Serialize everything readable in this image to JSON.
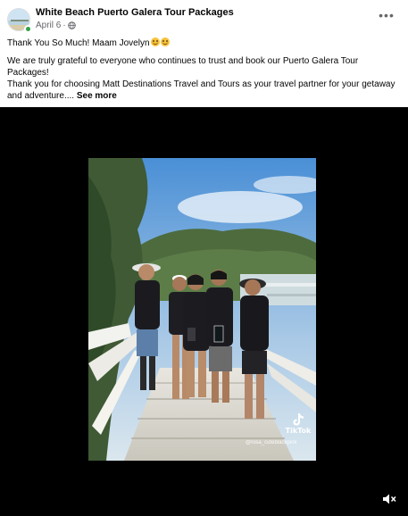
{
  "post": {
    "page_name": "White Beach Puerto Galera Tour Packages",
    "date": "April 6",
    "separator": "·",
    "more_label": "•••",
    "line1": "Thank You So Much! Maam Jovelyn",
    "line2": "We are truly grateful to everyone who continues to trust and book our Puerto Galera Tour Packages!",
    "line3": "Thank you for choosing Matt Destinations Travel and Tours as your travel partner for your getaway and adventure....",
    "see_more": "See more"
  },
  "video": {
    "tiktok_label": "TikTok",
    "tiktok_handle": "@rosa_cuteblackpink"
  },
  "icons": {
    "globe": "globe-icon",
    "more": "more-dots-icon",
    "mute": "speaker-muted-icon",
    "tiktok": "tiktok-logo-icon"
  },
  "colors": {
    "online": "#31a24c",
    "secondary_text": "#65676b",
    "video_bg": "#000000"
  }
}
